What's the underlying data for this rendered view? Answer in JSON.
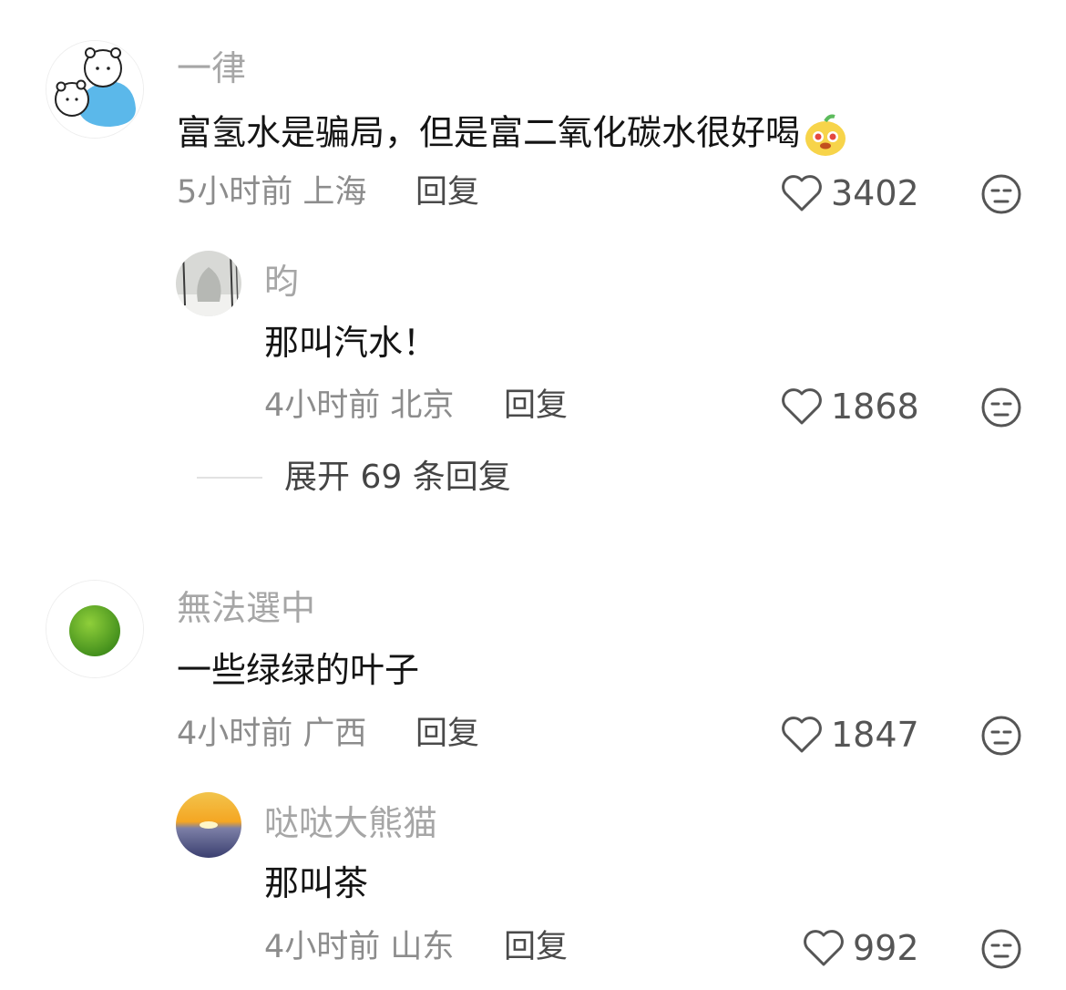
{
  "comments": [
    {
      "user": "一律",
      "text": "富氢水是骗局，但是富二氧化碳水很好喝",
      "time": "5小时前",
      "location": "上海",
      "reply_label": "回复",
      "likes": "3402",
      "avatar_icon": "bear-avatar"
    },
    {
      "user": "昀",
      "text": "那叫汽水！",
      "time": "4小时前",
      "location": "北京",
      "reply_label": "回复",
      "likes": "1868",
      "avatar_icon": "snowy-tree-avatar"
    },
    {
      "user": "無法選中",
      "text": "一些绿绿的叶子",
      "time": "4小时前",
      "location": "广西",
      "reply_label": "回复",
      "likes": "1847",
      "avatar_icon": "lime-avatar"
    },
    {
      "user": "哒哒大熊猫",
      "text": "那叫茶",
      "time": "4小时前",
      "location": "山东",
      "reply_label": "回复",
      "likes": "992",
      "avatar_icon": "sunset-avatar"
    }
  ],
  "expand_replies": "展开 69 条回复",
  "colors": {
    "username": "#a6a6a6",
    "text": "#141414",
    "meta": "#8c8c8c",
    "icon": "#555555"
  }
}
